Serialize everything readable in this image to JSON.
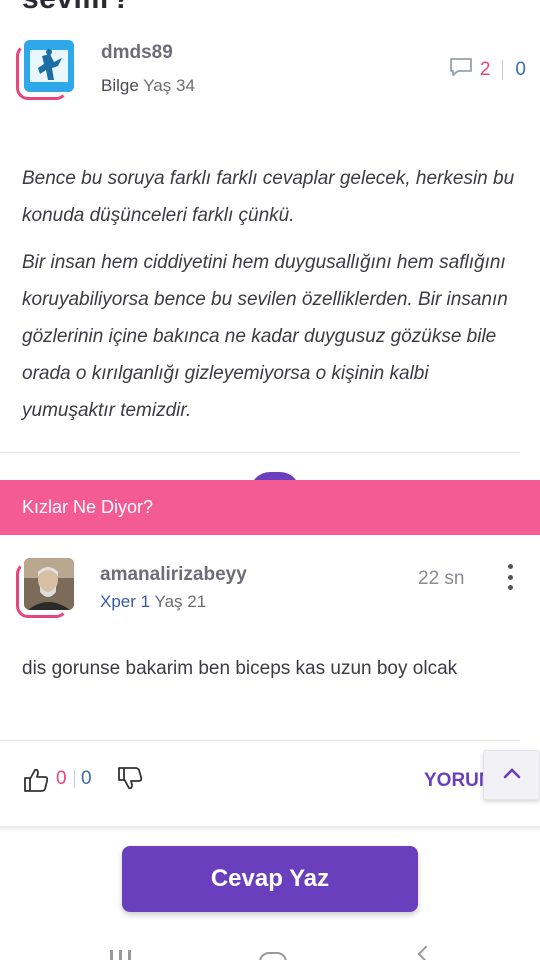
{
  "question": {
    "title_fragment": "sevilir?"
  },
  "answer": {
    "author": {
      "name": "dmds89",
      "level": "Bilge",
      "age": "Yaş 34"
    },
    "stats": {
      "comments": "2",
      "shares": "0"
    },
    "paragraphs": [
      "Bence bu soruya farklı farklı cevaplar gelecek, herkesin bu konuda düşünceleri farklı çünkü.",
      "Bir insan hem ciddiyetini hem duygusallığını hem saflığını koruyabiliyorsa bence bu sevilen özelliklerden. Bir insanın gözlerinin içine bakınca ne kadar duygusuz gözükse bile orada o kırılganlığı gizleyemiyorsa o kişinin kalbi yumuşaktır temizdir."
    ]
  },
  "section": {
    "title": "Kızlar Ne Diyor?"
  },
  "comment": {
    "author": {
      "name": "amanalirizabeyy",
      "level": "Xper 1",
      "age": "Yaş 21"
    },
    "time": "22 sn",
    "text": "dis gorunse bakarim ben biceps kas uzun boy olcak",
    "likes": "0",
    "dislikes": "0",
    "reply_label": "YORUM"
  },
  "cta": {
    "label": "Cevap Yaz"
  },
  "colors": {
    "accent_purple": "#6a3fbd",
    "accent_pink": "#f45b95"
  }
}
